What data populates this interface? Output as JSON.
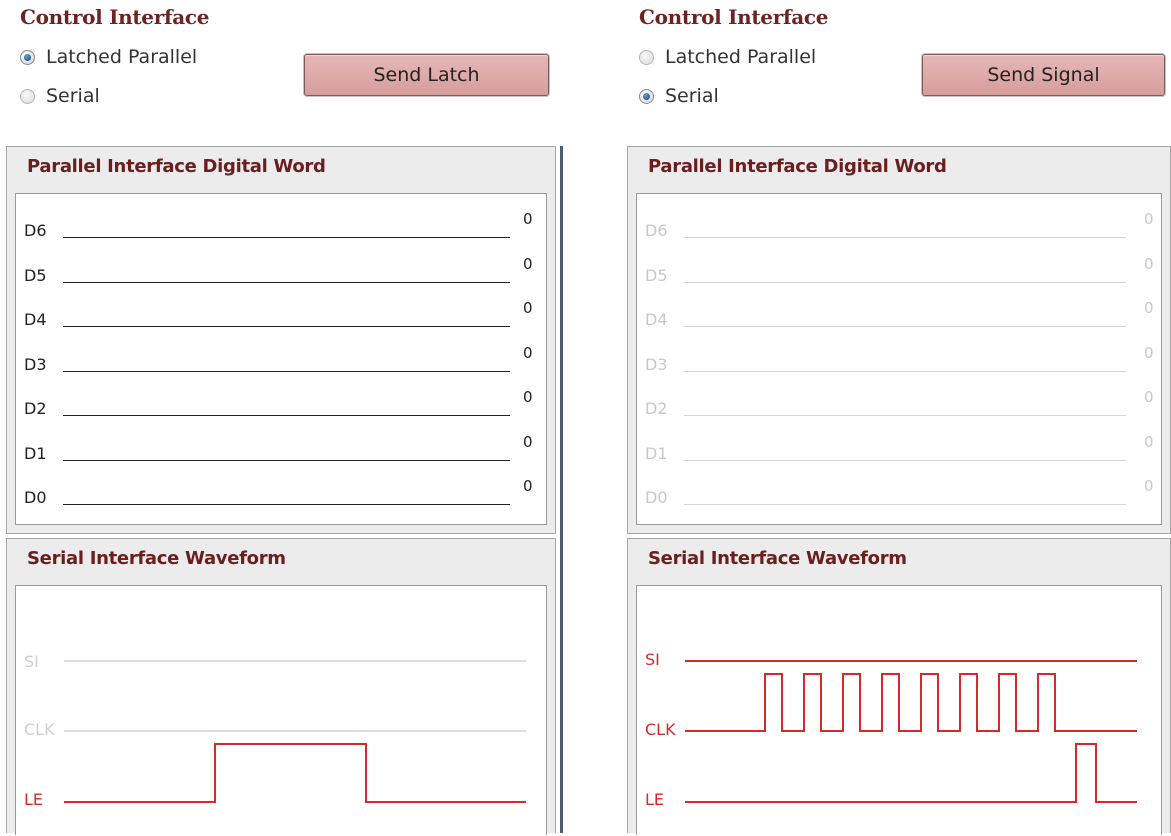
{
  "left": {
    "title": "Control Interface",
    "radios": [
      {
        "label": "Latched Parallel",
        "checked": true
      },
      {
        "label": "Serial",
        "checked": false
      }
    ],
    "button_label": "Send Latch",
    "parallel": {
      "title": "Parallel Interface Digital Word",
      "enabled": true,
      "bits": [
        {
          "name": "D6",
          "value": "0"
        },
        {
          "name": "D5",
          "value": "0"
        },
        {
          "name": "D4",
          "value": "0"
        },
        {
          "name": "D3",
          "value": "0"
        },
        {
          "name": "D2",
          "value": "0"
        },
        {
          "name": "D1",
          "value": "0"
        },
        {
          "name": "D0",
          "value": "0"
        }
      ]
    },
    "serial": {
      "title": "Serial Interface Waveform",
      "signals": [
        {
          "name": "SI",
          "active": false
        },
        {
          "name": "CLK",
          "active": false
        },
        {
          "name": "LE",
          "active": true
        }
      ]
    }
  },
  "right": {
    "title": "Control Interface",
    "radios": [
      {
        "label": "Latched Parallel",
        "checked": false
      },
      {
        "label": "Serial",
        "checked": true
      }
    ],
    "button_label": "Send Signal",
    "parallel": {
      "title": "Parallel Interface Digital Word",
      "enabled": false,
      "bits": [
        {
          "name": "D6",
          "value": "0"
        },
        {
          "name": "D5",
          "value": "0"
        },
        {
          "name": "D4",
          "value": "0"
        },
        {
          "name": "D3",
          "value": "0"
        },
        {
          "name": "D2",
          "value": "0"
        },
        {
          "name": "D1",
          "value": "0"
        },
        {
          "name": "D0",
          "value": "0"
        }
      ]
    },
    "serial": {
      "title": "Serial Interface Waveform",
      "signals": [
        {
          "name": "SI",
          "active": true
        },
        {
          "name": "CLK",
          "active": true
        },
        {
          "name": "LE",
          "active": true
        }
      ]
    }
  },
  "colors": {
    "active_signal": "#d42a2a",
    "inactive_signal": "#d0d0d0",
    "title_text": "#6b1e1e"
  }
}
